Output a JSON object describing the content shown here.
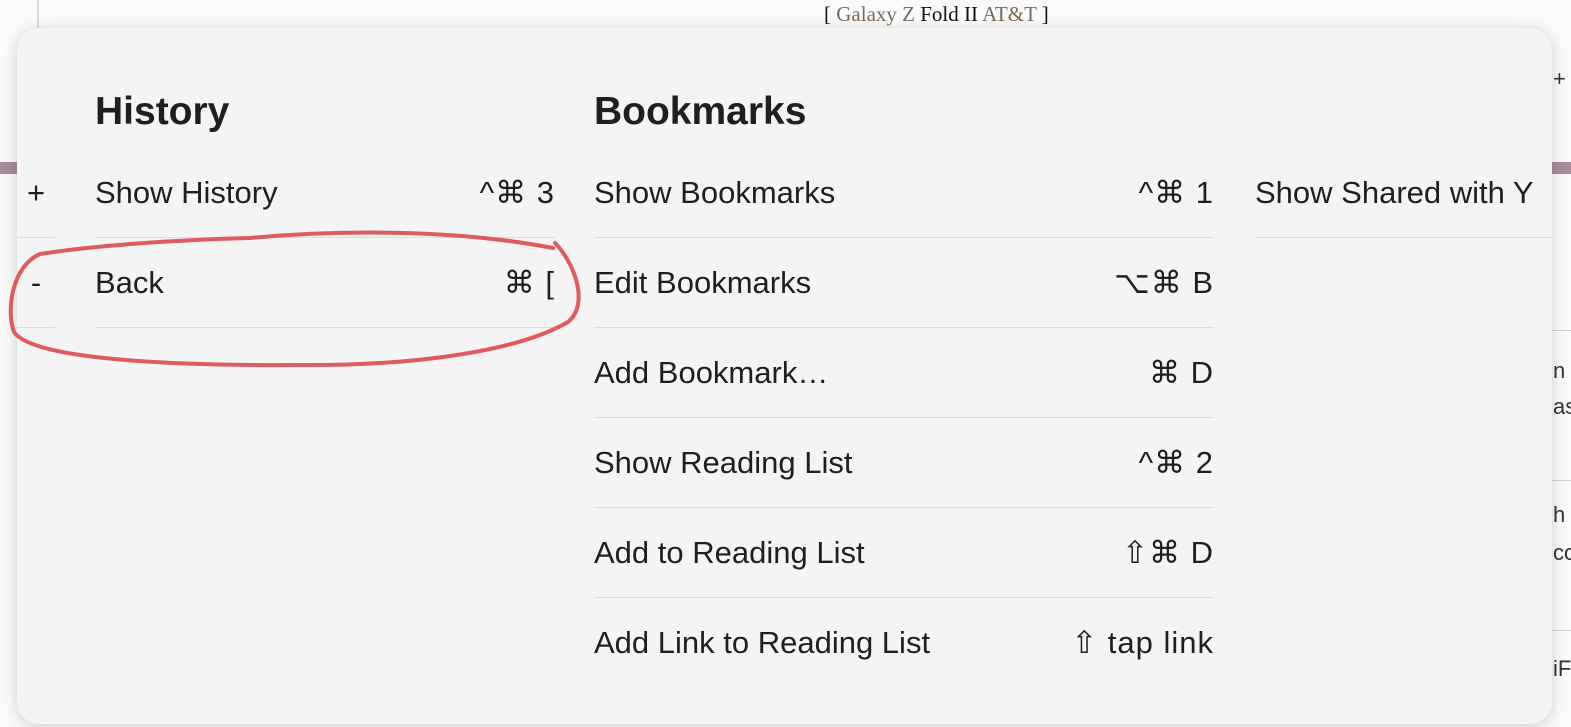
{
  "background": {
    "header_parts": [
      "[",
      "Galaxy Z",
      "Fold II",
      "AT&T",
      "]"
    ],
    "right_edge_fragments": [
      "+",
      "n",
      "as",
      "h",
      "co",
      "iF"
    ]
  },
  "history": {
    "title": "History",
    "items": [
      {
        "marker": "+",
        "label": "Show History",
        "shortcut": "^⌘ 3"
      },
      {
        "marker": "-",
        "label": "Back",
        "shortcut": "⌘ ["
      }
    ]
  },
  "bookmarks": {
    "title": "Bookmarks",
    "items": [
      {
        "label": "Show Bookmarks",
        "shortcut": "^⌘ 1"
      },
      {
        "label": "Edit Bookmarks",
        "shortcut": "⌥⌘ B"
      },
      {
        "label": "Add Bookmark…",
        "shortcut": "⌘ D"
      },
      {
        "label": "Show Reading List",
        "shortcut": "^⌘ 2"
      },
      {
        "label": "Add to Reading List",
        "shortcut": "⇧⌘ D"
      },
      {
        "label": "Add Link to Reading List",
        "shortcut": "⇧ tap link"
      }
    ]
  },
  "third_column": {
    "items": [
      {
        "label": "Show Shared with Y"
      }
    ]
  },
  "annotation": {
    "color": "#e05a5f"
  }
}
